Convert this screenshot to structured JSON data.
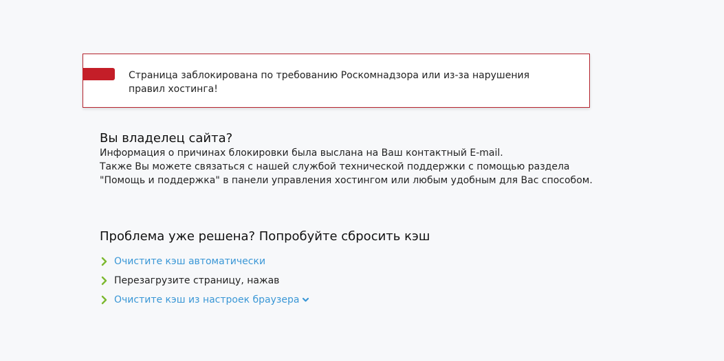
{
  "alert": {
    "message": "Страница заблокирована по требованию Роскомнадзора или из-за нарушения правил хостинга!"
  },
  "owner": {
    "title": "Вы владелец сайта?",
    "line1": "Информация о причинах блокировки была выслана на Ваш контактный E-mail.",
    "line2": "Также Вы можете связаться с нашей службой технической поддержки с помощью раздела",
    "line3": "\"Помощь и поддержка\" в панели управления хостингом или любым удобным для Вас способом."
  },
  "cache": {
    "title": "Проблема уже решена? Попробуйте сбросить кэш",
    "items": [
      {
        "label": "Очистите кэш автоматически"
      },
      {
        "label": "Перезагрузите страницу, нажав"
      },
      {
        "label": "Очистите кэш из настроек браузера"
      }
    ]
  },
  "colors": {
    "accent_red": "#c41e28",
    "border_red": "#b5222c",
    "link_blue": "#3a97d6",
    "chevron_green": "#7cb82f",
    "background": "#f7f8fa"
  },
  "icons": {
    "alert_flag": "flag-icon",
    "bullet": "chevron-right-icon",
    "dropdown": "chevron-down-icon"
  }
}
